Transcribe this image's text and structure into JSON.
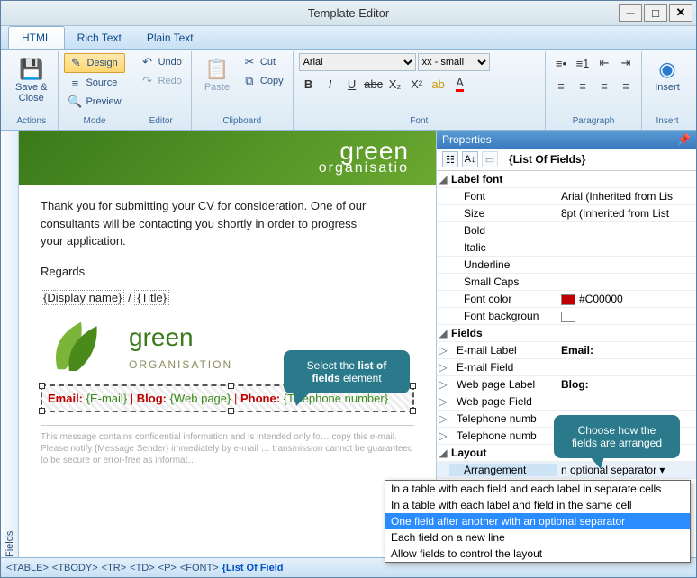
{
  "window": {
    "title": "Template Editor"
  },
  "tabs": {
    "html": "HTML",
    "rich": "Rich Text",
    "plain": "Plain Text"
  },
  "ribbon": {
    "actions": {
      "label": "Actions",
      "save": "Save &\nClose"
    },
    "mode": {
      "label": "Mode",
      "design": "Design",
      "source": "Source",
      "preview": "Preview"
    },
    "editor": {
      "label": "Editor",
      "undo": "Undo",
      "redo": "Redo"
    },
    "clipboard": {
      "label": "Clipboard",
      "paste": "Paste",
      "cut": "Cut",
      "copy": "Copy"
    },
    "font": {
      "label": "Font",
      "family": "Arial",
      "size": "xx - small"
    },
    "paragraph": {
      "label": "Paragraph"
    },
    "insert": {
      "label": "Insert",
      "btn": "Insert"
    }
  },
  "side": {
    "fields": "Fields"
  },
  "doc": {
    "banner_line1": "green",
    "banner_line2": "organisatio",
    "para": "Thank you for submitting your CV for consideration. One of our consultants will be contacting you shortly in order to progress your application.",
    "regards": "Regards",
    "display_name": "{Display name}",
    "sep": " / ",
    "title": "{Title}",
    "logo_word": "green",
    "logo_sub": "ORGANISATION",
    "lof": {
      "email_lbl": "Email:",
      "email_val": "{E-mail}",
      "blog_lbl": "Blog:",
      "blog_val": "{Web page}",
      "phone_lbl": "Phone:",
      "phone_val": "{Telephone number}",
      "sep": " | "
    },
    "disclaimer": "This message contains confidential information and is intended only fo… copy this e-mail. Please notify {Message Sender} immediately by e-mail … transmission cannot be guaranteed to be secure or error-free as informat…"
  },
  "callouts": {
    "c1a": "Select the ",
    "c1b": "list of fields",
    "c1c": " element",
    "c2": "Choose how the fields are arranged"
  },
  "props": {
    "title": "Properties",
    "selection": "{List Of Fields}",
    "cats": {
      "labelfont": "Label font",
      "fields": "Fields",
      "layout": "Layout"
    },
    "rows": {
      "font": "Font",
      "font_v": "Arial (Inherited from Lis",
      "size": "Size",
      "size_v": "8pt (Inherited from List",
      "bold": "Bold",
      "italic": "Italic",
      "underline": "Underline",
      "smallcaps": "Small Caps",
      "fontcolor": "Font color",
      "fontcolor_v": "#C00000",
      "fontbg": "Font backgroun",
      "emaillbl": "E-mail Label",
      "emaillbl_v": "Email:",
      "emailfld": "E-mail Field",
      "weblbl": "Web page Label",
      "weblbl_v": "Blog:",
      "webfld": "Web page Field",
      "telLbl": "Telephone numb",
      "telFld": "Telephone numb",
      "arrangement": "Arrangement",
      "arrangement_v": "n optional separator"
    }
  },
  "dropdown": {
    "o1": "In a table with each field and each label in separate cells",
    "o2": "In a table with each label and field in the same cell",
    "o3": "One field after another with an optional separator",
    "o4": "Each field on a new line",
    "o5": "Allow fields to control the layout"
  },
  "status": {
    "c1": "<TABLE>",
    "c2": "<TBODY>",
    "c3": "<TR>",
    "c4": "<TD>",
    "c5": "<P>",
    "c6": "<FONT>",
    "c7": "{List Of Field"
  }
}
